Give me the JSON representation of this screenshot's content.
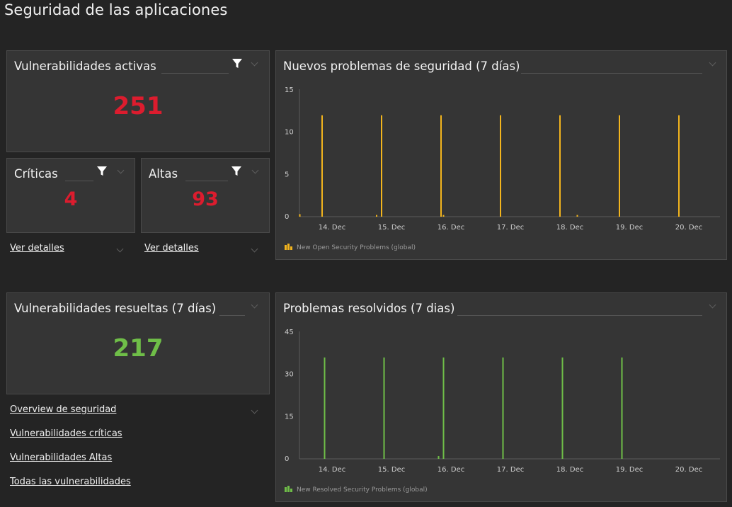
{
  "page": {
    "title": "Seguridad de las aplicaciones"
  },
  "tiles": {
    "active": {
      "title": "Vulnerabilidades activas",
      "value": "251"
    },
    "critical": {
      "title": "Críticas",
      "value": "4",
      "link": "Ver detalles"
    },
    "high": {
      "title": "Altas",
      "value": "93",
      "link": "Ver detalles"
    },
    "resolved": {
      "title": "Vulnerabilidades resueltas (7 días)",
      "value": "217"
    }
  },
  "links": [
    "Overview de seguridad",
    "Vulnerabilidades críticas",
    "Vulnerabilidades Altas",
    "Todas las vulnerabilidades"
  ],
  "colors": {
    "red": "#dc1c2e",
    "green": "#6fbe48",
    "yellow": "#f3b51d"
  },
  "chart_data": [
    {
      "type": "bar",
      "title": "Nuevos problemas de seguridad (7 días)",
      "x": [
        "14. Dec",
        "15. Dec",
        "16. Dec",
        "17. Dec",
        "18. Dec",
        "19. Dec",
        "20. Dec"
      ],
      "ylim": [
        0,
        15
      ],
      "yticks": [
        0,
        5,
        10,
        15
      ],
      "series": [
        {
          "name": "New Open Security Problems (global)",
          "color": "#f3b51d",
          "points": [
            {
              "t": "13. Dec 11:00",
              "v": 0.3
            },
            {
              "t": "13. Dec 20:00",
              "v": 12
            },
            {
              "t": "14. Dec 18:00",
              "v": 0.2
            },
            {
              "t": "14. Dec 20:00",
              "v": 12
            },
            {
              "t": "15. Dec 20:00",
              "v": 12
            },
            {
              "t": "15. Dec 21:00",
              "v": 0.2
            },
            {
              "t": "16. Dec 20:00",
              "v": 12
            },
            {
              "t": "17. Dec 20:00",
              "v": 12
            },
            {
              "t": "18. Dec 3:00",
              "v": 0.2
            },
            {
              "t": "18. Dec 20:00",
              "v": 12
            },
            {
              "t": "19. Dec 20:00",
              "v": 12
            }
          ]
        }
      ]
    },
    {
      "type": "bar",
      "title": "Problemas resolvidos (7 dias)",
      "x": [
        "14. Dec",
        "15. Dec",
        "16. Dec",
        "17. Dec",
        "18. Dec",
        "19. Dec",
        "20. Dec"
      ],
      "ylim": [
        0,
        45
      ],
      "yticks": [
        0,
        15,
        30,
        45
      ],
      "series": [
        {
          "name": "New Resolved Security Problems (global)",
          "color": "#6fbe48",
          "points": [
            {
              "t": "13. Dec 21:00",
              "v": 36
            },
            {
              "t": "14. Dec 21:00",
              "v": 36
            },
            {
              "t": "15. Dec 19:00",
              "v": 1
            },
            {
              "t": "15. Dec 21:00",
              "v": 36
            },
            {
              "t": "16. Dec 21:00",
              "v": 36
            },
            {
              "t": "17. Dec 21:00",
              "v": 36
            },
            {
              "t": "18. Dec 21:00",
              "v": 36
            }
          ]
        }
      ]
    }
  ]
}
